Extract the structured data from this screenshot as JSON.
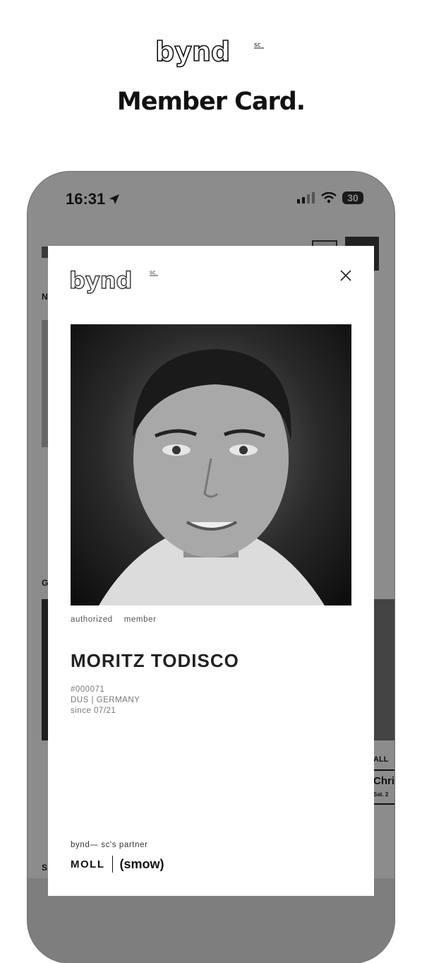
{
  "promo": {
    "logo_text": "bynd",
    "logo_superscript": "sc",
    "title": "Member Card."
  },
  "status_bar": {
    "time": "16:31",
    "battery_level": "30"
  },
  "background_app": {
    "visible_fragments": [
      "N",
      "G",
      "ALL",
      "Chris",
      "Sat. 2",
      "S"
    ]
  },
  "card": {
    "logo_text": "bynd",
    "logo_superscript": "sc",
    "role_left": "authorized",
    "role_right": "member",
    "name": "MORITZ TODISCO",
    "member_number": "#000071",
    "location": "DUS | GERMANY",
    "since": "since 07/21",
    "partner_label": "bynd— sc's partner",
    "partners": [
      "MOLL",
      "(smow)"
    ]
  },
  "colors": {
    "overlay": "#8c8c8c",
    "card_background": "#ffffff",
    "text_primary": "#222222"
  }
}
